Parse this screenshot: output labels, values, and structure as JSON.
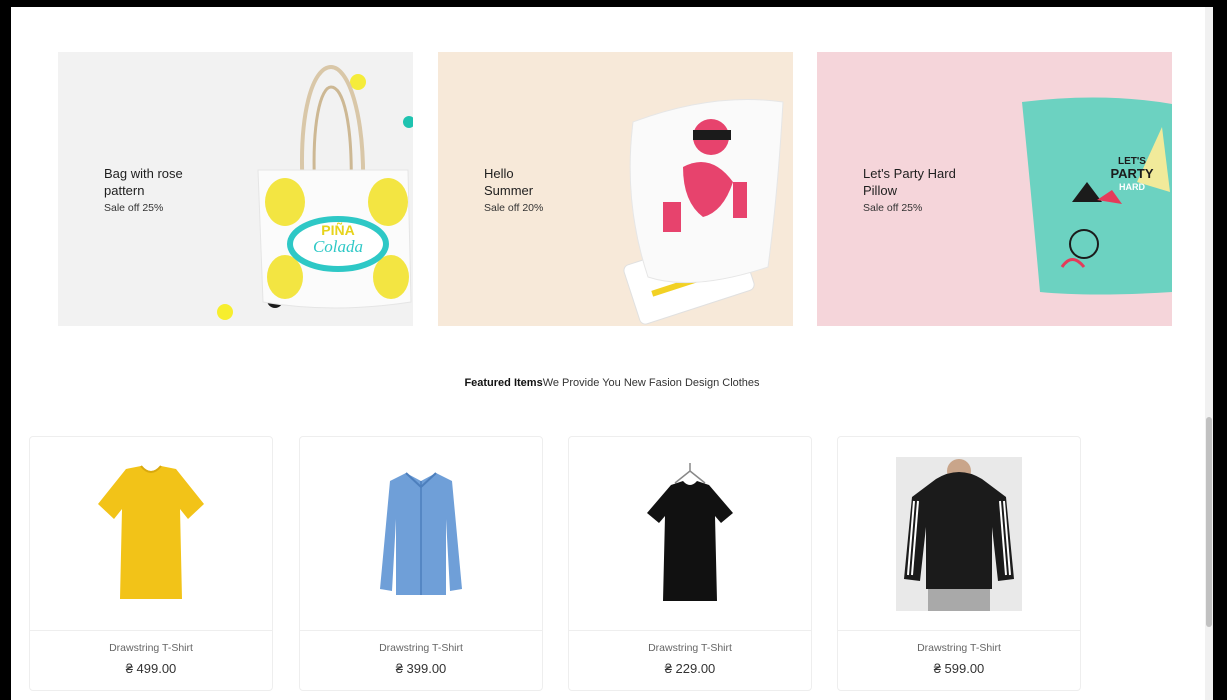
{
  "banners": [
    {
      "title_line1": "Bag with rose",
      "title_line2": "pattern",
      "sale": "Sale off 25%",
      "bg": "#f2f2f2",
      "image": "tote-bag-image",
      "bag_text_1": "PIÑA",
      "bag_text_2": "Colada"
    },
    {
      "title_line1": "Hello",
      "title_line2": "Summer",
      "sale": "Sale off 20%",
      "bg": "#f7e9d9",
      "image": "pillow-image"
    },
    {
      "title_line1": "Let's Party Hard",
      "title_line2": "Pillow",
      "sale": "Sale off 25%",
      "bg": "#f5d5da",
      "image": "party-pillow-image",
      "pillow_text_1": "LET'S",
      "pillow_text_2": "PARTY",
      "pillow_text_3": "HARD"
    }
  ],
  "featured": {
    "bold": "Featured Items",
    "rest": "We Provide You New Fasion Design Clothes"
  },
  "products": [
    {
      "name": "Drawstring T-Shirt",
      "price": "₴ 499.00",
      "image": "yellow-tshirt-image",
      "color": "#f2c318"
    },
    {
      "name": "Drawstring T-Shirt",
      "price": "₴ 399.00",
      "image": "blue-shirt-image",
      "color": "#6f9fd8"
    },
    {
      "name": "Drawstring T-Shirt",
      "price": "₴ 229.00",
      "image": "black-tshirt-image",
      "color": "#111111"
    },
    {
      "name": "Drawstring T-Shirt",
      "price": "₴ 599.00",
      "image": "black-hoodie-image",
      "color": "#1b1b1b"
    }
  ]
}
